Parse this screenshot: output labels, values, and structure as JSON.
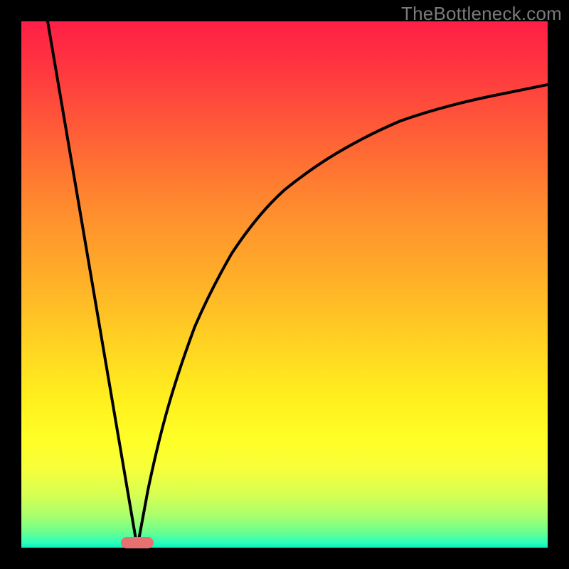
{
  "watermark": "TheBottleneck.com",
  "chart_data": {
    "type": "line",
    "title": "",
    "xlabel": "",
    "ylabel": "",
    "xlim": [
      0,
      100
    ],
    "ylim": [
      0,
      100
    ],
    "grid": false,
    "legend": false,
    "series": [
      {
        "name": "left-segment",
        "x": [
          5,
          22
        ],
        "y": [
          100,
          0
        ]
      },
      {
        "name": "right-segment",
        "x": [
          22,
          24,
          26,
          28,
          30,
          33,
          36,
          40,
          45,
          50,
          55,
          60,
          66,
          72,
          80,
          90,
          100
        ],
        "y": [
          0,
          11,
          20,
          27,
          34,
          42,
          49,
          56,
          63,
          68,
          72,
          76,
          79,
          82,
          84,
          86,
          88
        ]
      }
    ],
    "marker": {
      "x": 22,
      "y": 0,
      "color": "#e77070"
    },
    "background_gradient": {
      "top": "#ff1e46",
      "mid": "#ffd522",
      "bottom": "#0cf0c0"
    }
  }
}
